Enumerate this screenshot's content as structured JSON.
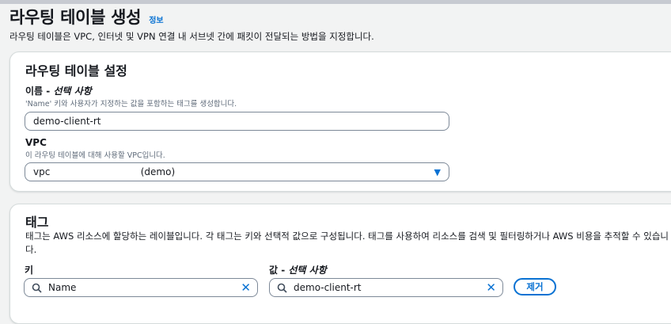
{
  "header": {
    "title": "라우팅 테이블 생성",
    "info_link": "정보",
    "description": "라우팅 테이블은 VPC, 인터넷 및 VPN 연결 내 서브넷 간에 패킷이 전달되는 방법을 지정합니다."
  },
  "settings": {
    "title": "라우팅 테이블 설정",
    "name_label": "이름",
    "name_optional": "선택 사항",
    "name_hint": "'Name' 키와 사용자가 지정하는 값을 포함하는 태그를 생성합니다.",
    "name_value": "demo-client-rt",
    "vpc_label": "VPC",
    "vpc_hint": "이 라우팅 테이블에 대해 사용할 VPC입니다.",
    "vpc_value": "vpc                              (demo)"
  },
  "tags": {
    "title": "태그",
    "description": "태그는 AWS 리소스에 할당하는 레이블입니다. 각 태그는 키와 선택적 값으로 구성됩니다. 태그를 사용하여 리소스를 검색 및 필터링하거나 AWS 비용을 추적할 수 있습니다.",
    "key_label": "키",
    "value_label": "값",
    "value_optional": "선택 사항",
    "rows": [
      {
        "key": "Name",
        "value": "demo-client-rt"
      }
    ],
    "remove_label": "제거"
  },
  "colors": {
    "link": "#0972d3",
    "border": "#7d8998",
    "hint": "#5f6b7a"
  },
  "icons": {
    "search": "search-icon",
    "clear": "clear-icon",
    "dropdown": "caret-down-icon"
  }
}
